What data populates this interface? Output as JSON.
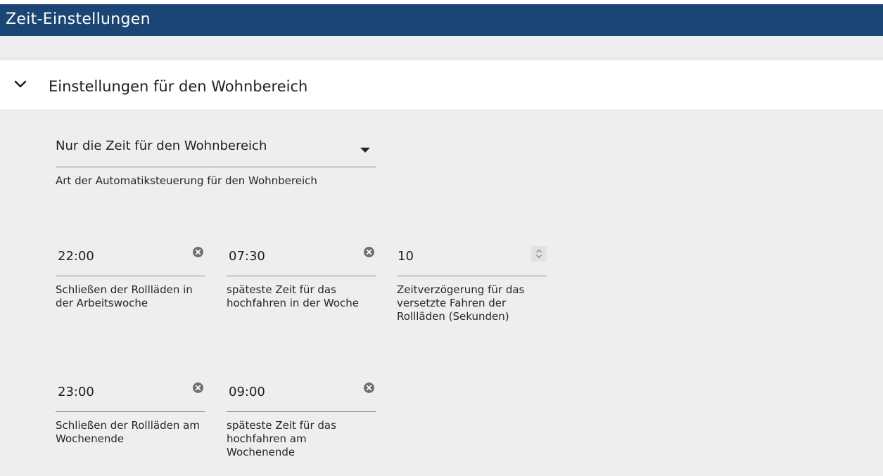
{
  "window": {
    "title": "Zeit-Einstellungen"
  },
  "panel": {
    "title": "Einstellungen für den Wohnbereich",
    "mode_select": {
      "value": "Nur die Zeit für den Wohnbereich",
      "helper": "Art der Automatiksteuerung für den Wohnbereich"
    },
    "fields": {
      "close_workweek": {
        "value": "22:00",
        "label": "Schließen der Rollläden in der Arbeitswoche"
      },
      "latest_up_week": {
        "value": "07:30",
        "label": "späteste Zeit für das hochfahren in der Woche"
      },
      "delay": {
        "value": "10",
        "label": "Zeitverzögerung für das versetzte Fahren der Rollläden (Sekunden)"
      },
      "close_weekend": {
        "value": "23:00",
        "label": "Schließen der Rollläden am Wochenende"
      },
      "latest_up_weekend": {
        "value": "09:00",
        "label": "späteste Zeit für das hochfahren am Wochenende"
      }
    }
  },
  "icons": {
    "collapse": "chevron-down-icon",
    "dropdown": "caret-down-icon",
    "clear": "clear-circle-icon",
    "spinner": "spin-updown-icon"
  },
  "colors": {
    "titlebar": "#1a4574",
    "background": "#eeeeee"
  }
}
